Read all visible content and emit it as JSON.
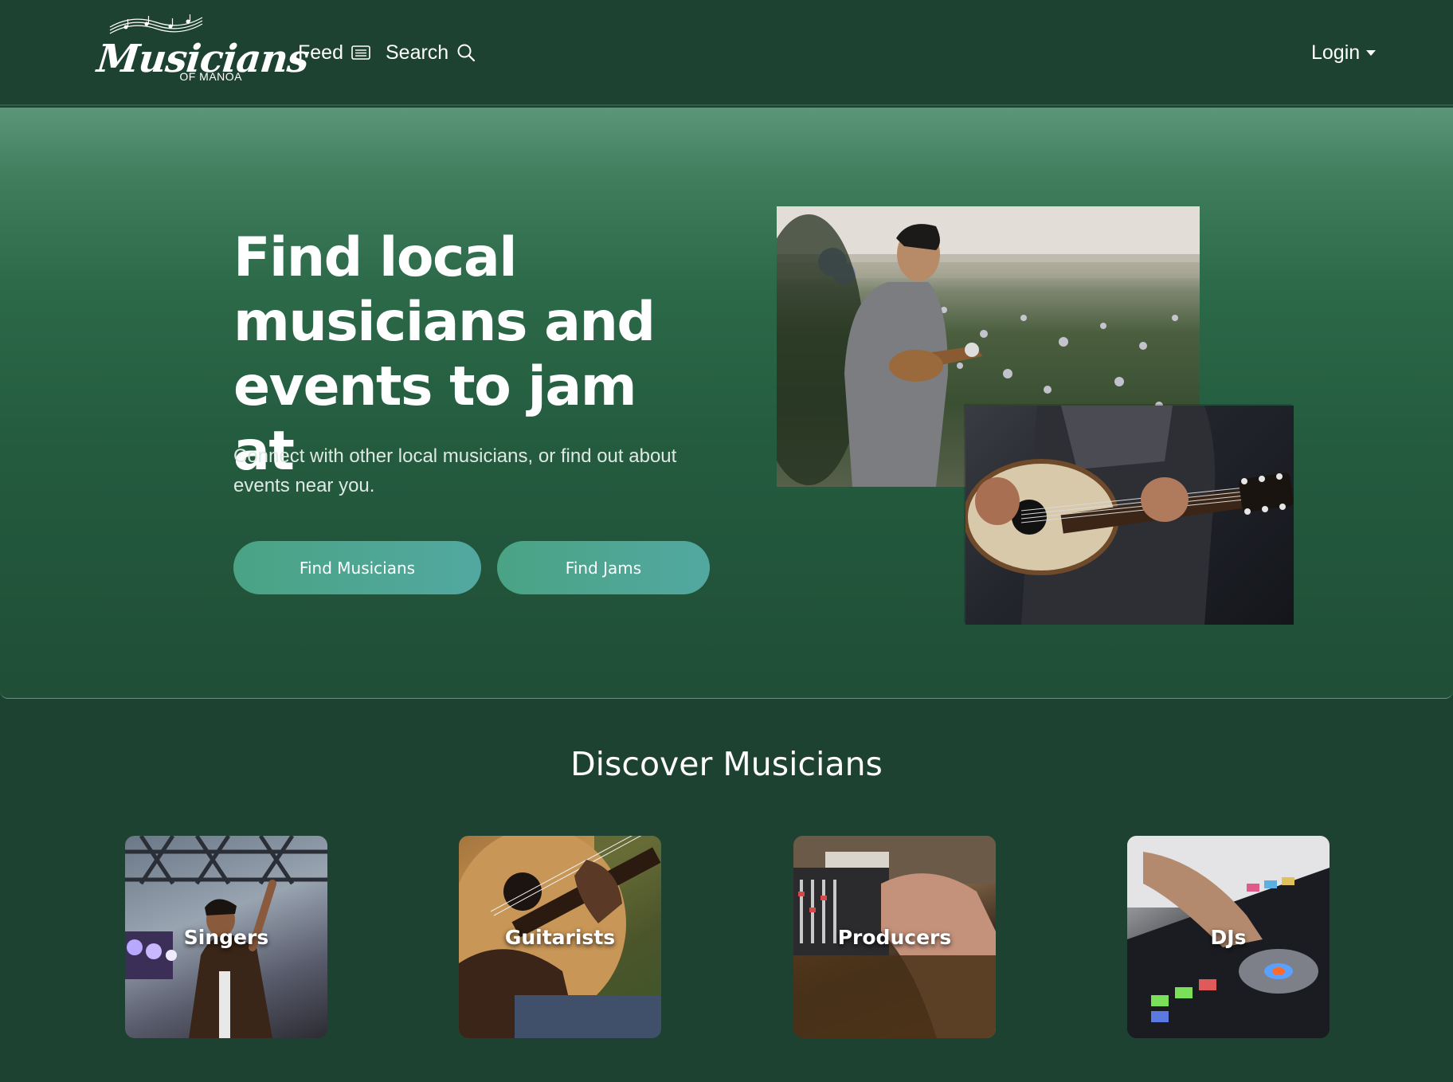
{
  "header": {
    "logo": {
      "word": "Musicians",
      "subtitle": "OF MANOA"
    },
    "nav": {
      "feed_label": "Feed",
      "search_label": "Search",
      "login_label": "Login"
    }
  },
  "hero": {
    "title": "Find local musicians and events to jam at",
    "subtitle": "Connect with other local musicians, or find out about events near you.",
    "buttons": {
      "find_musicians": "Find Musicians",
      "find_jams": "Find Jams"
    }
  },
  "discover": {
    "title": "Discover Musicians",
    "categories": [
      {
        "label": "Singers"
      },
      {
        "label": "Guitarists"
      },
      {
        "label": "Producers"
      },
      {
        "label": "DJs"
      }
    ]
  },
  "colors": {
    "background": "#1e4232",
    "button_gradient_start": "#4aa384",
    "button_gradient_end": "#52a8a0"
  }
}
